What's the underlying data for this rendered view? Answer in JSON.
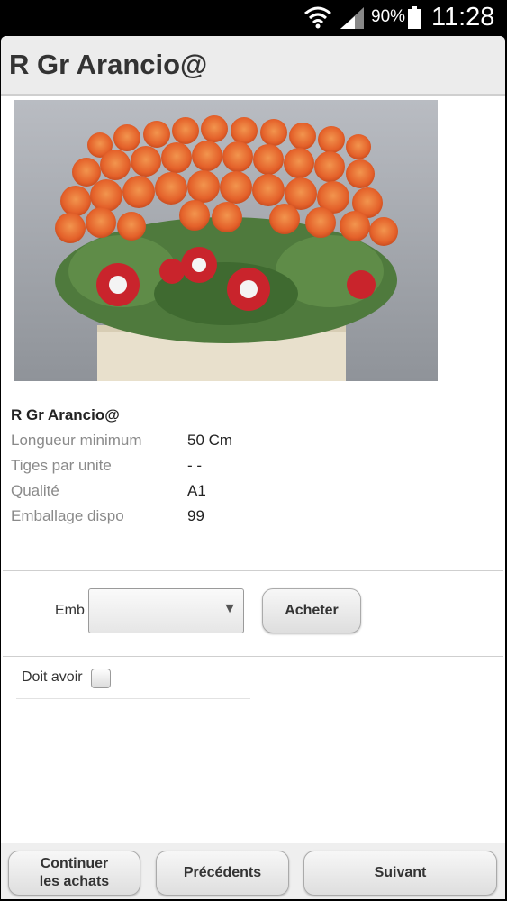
{
  "status_bar": {
    "battery_percent": "90%",
    "time": "11:28",
    "icons": [
      "wifi-icon",
      "signal-icon",
      "battery-icon"
    ]
  },
  "header": {
    "title": "R Gr Arancio@"
  },
  "product": {
    "name": "R Gr Arancio@",
    "image": "orange-roses-bouquet",
    "details": [
      {
        "label": "Longueur minimum",
        "value": "50 Cm"
      },
      {
        "label": "Tiges par unite",
        "value": "- -"
      },
      {
        "label": "Qualité",
        "value": "A1"
      },
      {
        "label": "Emballage dispo",
        "value": "99"
      }
    ]
  },
  "order": {
    "emb_label": "Emb",
    "emb_selected": "",
    "buy_label": "Acheter"
  },
  "options": {
    "doit_avoir_label": "Doit avoir",
    "doit_avoir_checked": false
  },
  "footer": {
    "continue_line1": "Continuer",
    "continue_line2": "les achats",
    "previous_label": "Précédents",
    "next_label": "Suivant"
  },
  "colors": {
    "header_bg": "#ececec",
    "title_text": "#333333",
    "label_text": "#8a8a8a",
    "rose_orange": "#e8672a"
  }
}
